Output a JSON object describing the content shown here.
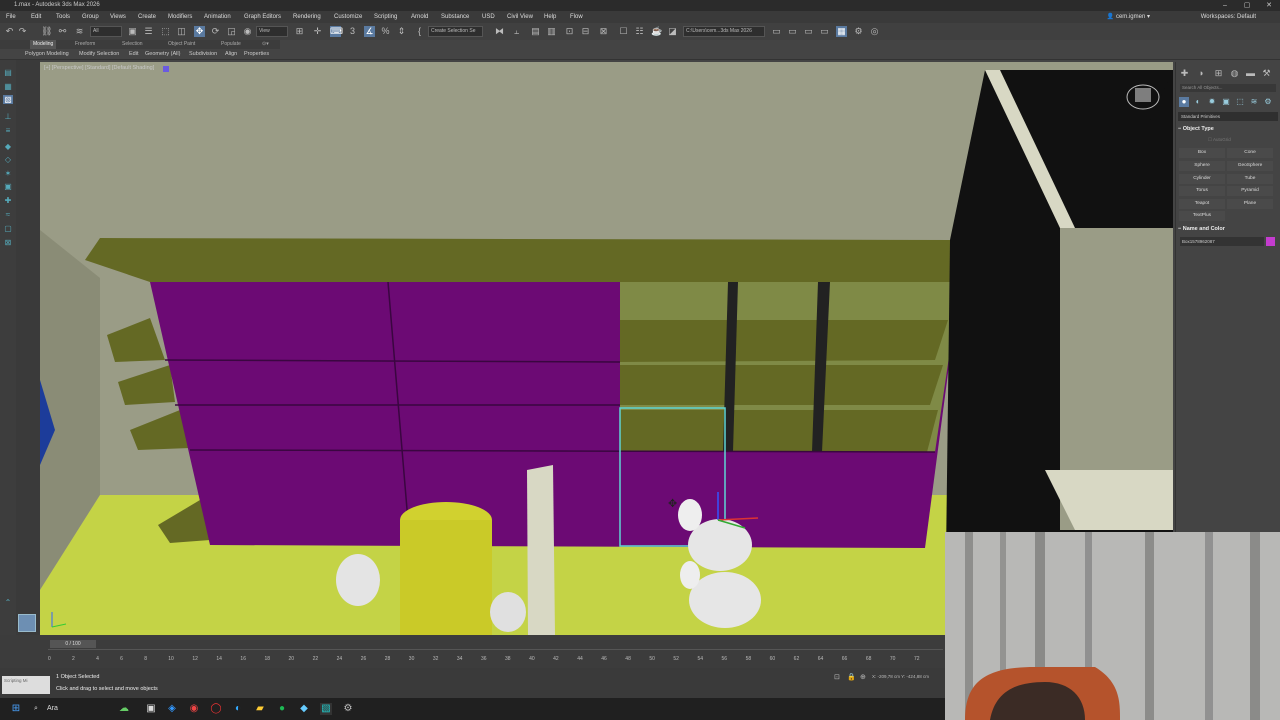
{
  "window": {
    "title": "1.max - Autodesk 3ds Max 2026",
    "controls": [
      "–",
      "▢",
      "✕"
    ]
  },
  "menu": {
    "items": [
      "File",
      "Edit",
      "Tools",
      "Group",
      "Views",
      "Create",
      "Modifiers",
      "Animation",
      "Graph Editors",
      "Rendering",
      "Customize",
      "Scripting",
      "Arnold",
      "Substance",
      "USD",
      "Civil View",
      "Help",
      "Flow"
    ],
    "user": "cem.igmen",
    "workspaces_label": "Workspaces: Default"
  },
  "toolbar": {
    "selection_filter": "All",
    "view_dropdown": "View",
    "named_selection": "Create Selection Se",
    "path": "C:\\Users\\cem...3ds Max 2026"
  },
  "ribbon": {
    "tabs": [
      "Modeling",
      "Freeform",
      "Selection",
      "Object Paint",
      "Populate"
    ],
    "active_tab": "Modeling",
    "items": [
      "Polygon Modeling",
      "Modify Selection",
      "Edit",
      "Geometry (All)",
      "Subdivision",
      "Align",
      "Properties"
    ]
  },
  "viewport": {
    "label": "[+] [Perspective] [Standard] [Default Shading]",
    "colors": {
      "shelf": "#646924",
      "door": "#6c0a74",
      "floor": "#c4d346",
      "wall": "#9a9c86",
      "selection": "#5fd4d4"
    }
  },
  "command_panel": {
    "search_placeholder": "Search All Objects...",
    "category": "Standard Primitives",
    "object_type_title": "Object Type",
    "autogrid_label": "AutoGrid",
    "buttons": [
      "Box",
      "Cone",
      "Sphere",
      "GeoSphere",
      "Cylinder",
      "Tube",
      "Torus",
      "Pyramid",
      "Teapot",
      "Plane",
      "TextPlus"
    ],
    "name_color_title": "Name and Color",
    "object_name": "Box1578962087",
    "object_color": "#c43ccf"
  },
  "timeline": {
    "frame_label": "0 / 100",
    "ticks": [
      "0",
      "2",
      "4",
      "6",
      "8",
      "10",
      "12",
      "14",
      "16",
      "18",
      "20",
      "22",
      "24",
      "26",
      "28",
      "30",
      "32",
      "34",
      "36",
      "38",
      "40",
      "42",
      "44",
      "46",
      "48",
      "50",
      "52",
      "54",
      "56",
      "58",
      "60",
      "62",
      "64",
      "66",
      "68",
      "70",
      "72"
    ]
  },
  "status": {
    "maxscript": "Scripting Mi",
    "selection": "1 Object Selected",
    "hint": "Click and drag to select and move objects",
    "coords": "X: -209,78 cm  Y: -424,88 cm"
  },
  "taskbar": {
    "search_label": "Ara"
  }
}
